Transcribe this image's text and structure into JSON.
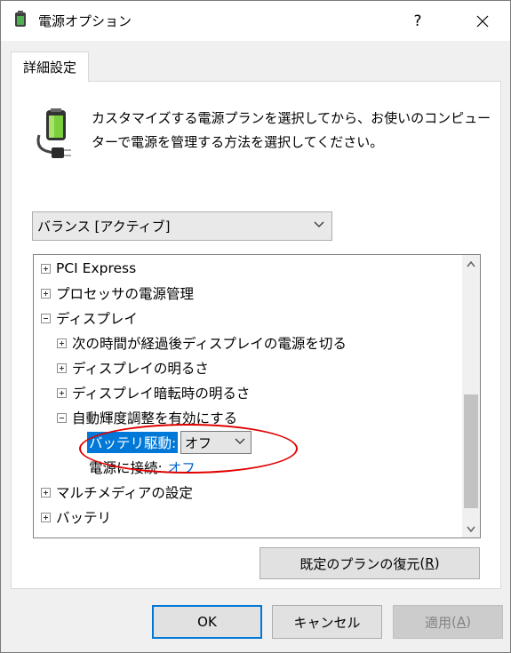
{
  "window": {
    "title": "電源オプション",
    "help": "?",
    "close_icon": "close-icon"
  },
  "tab": {
    "label": "詳細設定"
  },
  "description": {
    "line1": "カスタマイズする電源プランを選択してから、お使いのコンピュー",
    "line2": "ターで電源を管理する方法を選択してください。",
    "icon": "power-plug-battery-icon"
  },
  "plan_select": {
    "value": "バランス [アクティブ]"
  },
  "tree": {
    "items": [
      {
        "label": "PCI Express",
        "expanded": false
      },
      {
        "label": "プロセッサの電源管理",
        "expanded": false
      },
      {
        "label": "ディスプレイ",
        "expanded": true
      },
      {
        "label": "次の時間が経過後ディスプレイの電源を切る",
        "expanded": false
      },
      {
        "label": "ディスプレイの明るさ",
        "expanded": false
      },
      {
        "label": "ディスプレイ暗転時の明るさ",
        "expanded": false
      },
      {
        "label": "自動輝度調整を有効にする",
        "expanded": true
      },
      {
        "label": "マルチメディアの設定",
        "expanded": false
      },
      {
        "label": "バッテリ",
        "expanded": false
      }
    ],
    "battery_label": "バッテリ駆動:",
    "battery_value": "オフ",
    "ac_label": "電源に接続:",
    "ac_value": "オフ"
  },
  "buttons": {
    "restore": "既定のプランの復元",
    "restore_key": "R",
    "ok": "OK",
    "cancel": "キャンセル",
    "apply": "適用",
    "apply_key": "A"
  },
  "colors": {
    "selection": "#0078d7",
    "link": "#0066cc",
    "highlight_oval": "#e00000"
  }
}
